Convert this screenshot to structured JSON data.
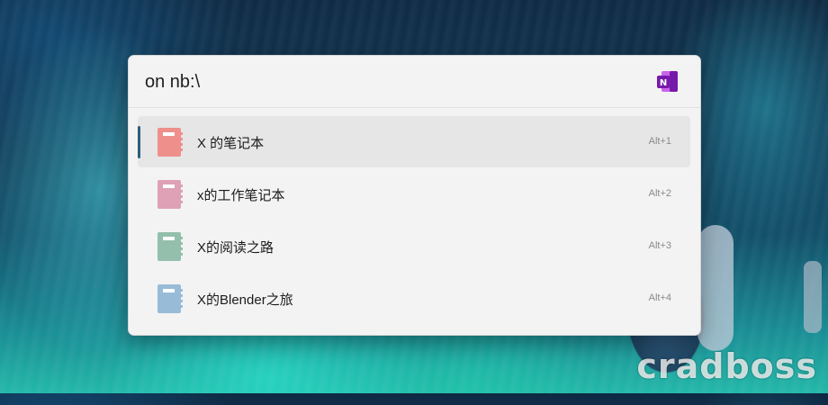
{
  "background": {
    "watermark": "cradboss"
  },
  "launcher": {
    "query": "on nb:\\",
    "plugin_icon": "onenote-icon",
    "accent_color": "#2b5f7e"
  },
  "results": [
    {
      "title": "X 的笔记本",
      "shortcut": "Alt+1",
      "icon": "notebook-icon",
      "color": "#ef8f8b",
      "selected": true
    },
    {
      "title": "x的工作笔记本",
      "shortcut": "Alt+2",
      "icon": "notebook-icon",
      "color": "#dea1b6",
      "selected": false
    },
    {
      "title": "X的阅读之路",
      "shortcut": "Alt+3",
      "icon": "notebook-icon",
      "color": "#93bfac",
      "selected": false
    },
    {
      "title": "X的Blender之旅",
      "shortcut": "Alt+4",
      "icon": "notebook-icon",
      "color": "#98bcd8",
      "selected": false
    }
  ]
}
